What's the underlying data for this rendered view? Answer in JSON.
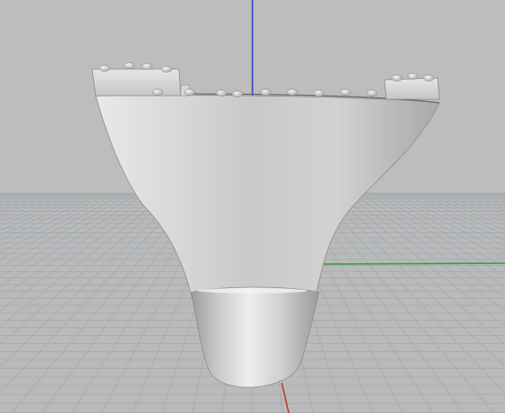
{
  "viewport": {
    "view": "perspective",
    "background_color": "#bdbdbd",
    "grid_color": "#a9adb0",
    "grid_major_color": "#9ea2a6",
    "object_color": "#d4d4d4",
    "axes": {
      "x_color": "#2fa13a",
      "y_color": "#c0392b",
      "z_color": "#2b2bd0"
    },
    "objects": [
      {
        "name": "funnel-shaped-part",
        "type": "surface"
      }
    ]
  }
}
